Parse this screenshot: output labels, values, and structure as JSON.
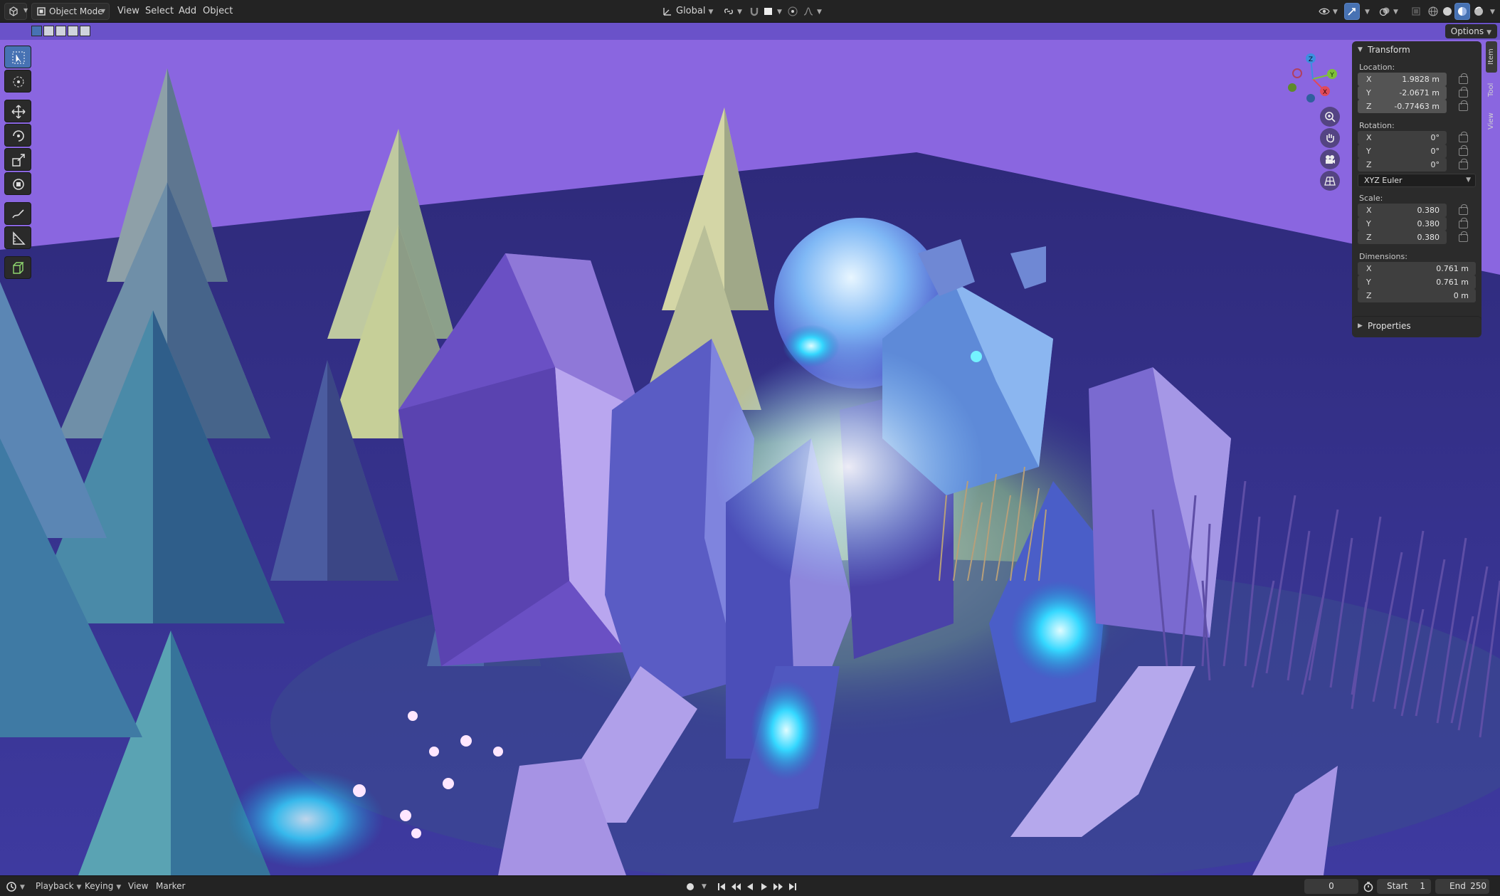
{
  "header": {
    "editor_type_icon": "3d-viewport-icon",
    "mode": "Object Mode",
    "menus": [
      "View",
      "Select",
      "Add",
      "Object"
    ],
    "transform_orientation": "Global",
    "options_label": "Options"
  },
  "sidebar_tabs": [
    "Item",
    "Tool",
    "View"
  ],
  "npanel": {
    "transform_title": "Transform",
    "location_label": "Location:",
    "location": [
      {
        "axis": "X",
        "value": "1.9828 m"
      },
      {
        "axis": "Y",
        "value": "-2.0671 m"
      },
      {
        "axis": "Z",
        "value": "-0.77463 m"
      }
    ],
    "rotation_label": "Rotation:",
    "rotation": [
      {
        "axis": "X",
        "value": "0°"
      },
      {
        "axis": "Y",
        "value": "0°"
      },
      {
        "axis": "Z",
        "value": "0°"
      }
    ],
    "rotation_mode": "XYZ Euler",
    "scale_label": "Scale:",
    "scale": [
      {
        "axis": "X",
        "value": "0.380"
      },
      {
        "axis": "Y",
        "value": "0.380"
      },
      {
        "axis": "Z",
        "value": "0.380"
      }
    ],
    "dimensions_label": "Dimensions:",
    "dimensions": [
      {
        "axis": "X",
        "value": "0.761 m"
      },
      {
        "axis": "Y",
        "value": "0.761 m"
      },
      {
        "axis": "Z",
        "value": "0 m"
      }
    ],
    "properties_title": "Properties"
  },
  "gizmo": {
    "x": "X",
    "y": "Y",
    "z": "Z"
  },
  "timeline": {
    "menus": [
      "Playback",
      "Keying",
      "View",
      "Marker"
    ],
    "current_frame": "0",
    "start_label": "Start",
    "start": "1",
    "end_label": "End",
    "end": "250"
  },
  "colors": {
    "accent": "#4772b3",
    "sky": "#8a66e0",
    "axis_x": "#e04a5a",
    "axis_y": "#7fbf3a",
    "axis_z": "#3d8fe0"
  }
}
